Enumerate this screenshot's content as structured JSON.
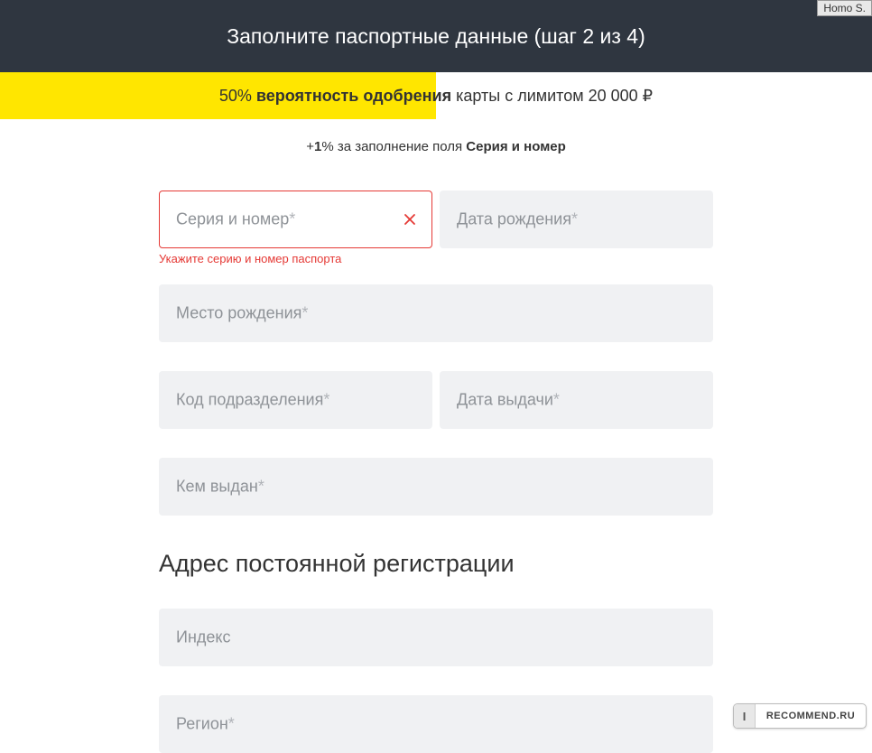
{
  "header": {
    "title": "Заполните паспортные данные (шаг 2 из 4)"
  },
  "approval": {
    "progress_percent": 50,
    "percent_label": "50%",
    "bold_text": "вероятность одобрения",
    "rest_text": " карты с лимитом 20 000 ₽"
  },
  "bonus": {
    "prefix": "+",
    "num": "1",
    "mid": "% за заполнение поля ",
    "field_name": "Серия и номер"
  },
  "fields": {
    "series_number": {
      "label": "Серия и номер",
      "required": true,
      "error": "Укажите серию и номер паспорта"
    },
    "birth_date": {
      "label": "Дата рождения",
      "required": true
    },
    "birth_place": {
      "label": "Место рождения",
      "required": true
    },
    "dept_code": {
      "label": "Код подразделения",
      "required": true
    },
    "issue_date": {
      "label": "Дата выдачи",
      "required": true
    },
    "issued_by": {
      "label": "Кем выдан",
      "required": true
    },
    "index": {
      "label": "Индекс",
      "required": false
    },
    "region": {
      "label": "Регион",
      "required": true
    }
  },
  "section": {
    "address_title": "Адрес постоянной регистрации"
  },
  "top_tag": "Homo S.",
  "watermark": {
    "i": "I",
    "text": "RECOMMEND.RU"
  }
}
